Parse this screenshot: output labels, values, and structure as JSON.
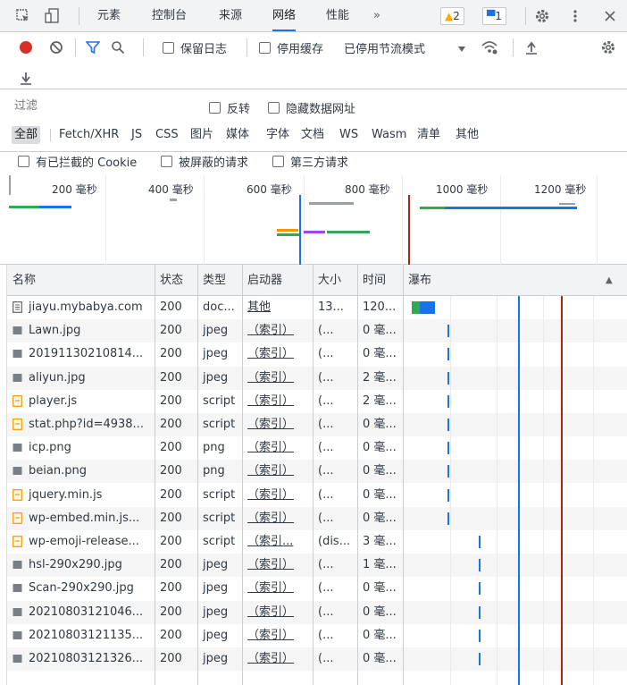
{
  "tabs": {
    "elements": "元素",
    "console": "控制台",
    "sources": "来源",
    "network": "网络",
    "performance": "性能",
    "more": "»",
    "warnings": "2",
    "messages": "1"
  },
  "toolbar": {
    "preserve_log": "保留日志",
    "disable_cache": "停用缓存",
    "throttling": "已停用节流模式"
  },
  "filter": {
    "placeholder": "过滤",
    "invert": "反转",
    "hide_data_urls": "隐藏数据网址",
    "types": [
      "全部",
      "Fetch/XHR",
      "JS",
      "CSS",
      "图片",
      "媒体",
      "字体",
      "文档",
      "WS",
      "Wasm",
      "清单",
      "其他"
    ],
    "blocked_cookies": "有已拦截的 Cookie",
    "blocked_requests": "被屏蔽的请求",
    "third_party": "第三方请求"
  },
  "overview": {
    "ticks": [
      "200 毫秒",
      "400 毫秒",
      "600 毫秒",
      "800 毫秒",
      "1000 毫秒",
      "1200 毫秒"
    ]
  },
  "table": {
    "headers": [
      "名称",
      "状态",
      "类型",
      "启动器",
      "大小",
      "时间",
      "瀑布"
    ],
    "rows": [
      {
        "name": "jiayu.mybabya.com",
        "status": "200",
        "type": "doc...",
        "initiator": "其他",
        "size": "13...",
        "time": "120...",
        "icon": "document-icon",
        "wf": 0.02
      },
      {
        "name": "Lawn.jpg",
        "status": "200",
        "type": "jpeg",
        "initiator": "（索引）",
        "size": "(...",
        "time": "0 毫...",
        "icon": "image-icon",
        "wf": 0.2
      },
      {
        "name": "20191130210814...",
        "status": "200",
        "type": "jpeg",
        "initiator": "（索引）",
        "size": "(...",
        "time": "0 毫...",
        "icon": "image-icon",
        "wf": 0.2
      },
      {
        "name": "aliyun.jpg",
        "status": "200",
        "type": "jpeg",
        "initiator": "（索引）",
        "size": "(...",
        "time": "2 毫...",
        "icon": "image-icon",
        "wf": 0.2
      },
      {
        "name": "player.js",
        "status": "200",
        "type": "script",
        "initiator": "（索引）",
        "size": "(...",
        "time": "2 毫...",
        "icon": "script-icon",
        "wf": 0.2
      },
      {
        "name": "stat.php?id=4938...",
        "status": "200",
        "type": "script",
        "initiator": "（索引）",
        "size": "(...",
        "time": "0 毫...",
        "icon": "script-icon",
        "wf": 0.2
      },
      {
        "name": "icp.png",
        "status": "200",
        "type": "png",
        "initiator": "（索引）",
        "size": "(...",
        "time": "0 毫...",
        "icon": "image-icon",
        "wf": 0.2
      },
      {
        "name": "beian.png",
        "status": "200",
        "type": "png",
        "initiator": "（索引）",
        "size": "(...",
        "time": "0 毫...",
        "icon": "image-icon",
        "wf": 0.2
      },
      {
        "name": "jquery.min.js",
        "status": "200",
        "type": "script",
        "initiator": "（索引）",
        "size": "(...",
        "time": "0 毫...",
        "icon": "script-icon",
        "wf": 0.2
      },
      {
        "name": "wp-embed.min.js...",
        "status": "200",
        "type": "script",
        "initiator": "（索引）",
        "size": "(...",
        "time": "0 毫...",
        "icon": "script-icon",
        "wf": 0.2
      },
      {
        "name": "wp-emoji-release...",
        "status": "200",
        "type": "script",
        "initiator": "（索引...",
        "size": "(dis...",
        "time": "3 毫...",
        "icon": "script-icon",
        "wf": 0.34
      },
      {
        "name": "hsl-290x290.jpg",
        "status": "200",
        "type": "jpeg",
        "initiator": "（索引）",
        "size": "(...",
        "time": "1 毫...",
        "icon": "image-icon",
        "wf": 0.34
      },
      {
        "name": "Scan-290x290.jpg",
        "status": "200",
        "type": "jpeg",
        "initiator": "（索引）",
        "size": "(...",
        "time": "0 毫...",
        "icon": "image-icon",
        "wf": 0.34
      },
      {
        "name": "20210803121046...",
        "status": "200",
        "type": "jpeg",
        "initiator": "（索引）",
        "size": "(...",
        "time": "0 毫...",
        "icon": "image-icon",
        "wf": 0.34
      },
      {
        "name": "20210803121135...",
        "status": "200",
        "type": "jpeg",
        "initiator": "（索引）",
        "size": "(...",
        "time": "0 毫...",
        "icon": "image-icon",
        "wf": 0.34
      },
      {
        "name": "20210803121326...",
        "status": "200",
        "type": "jpeg",
        "initiator": "（索引）",
        "size": "(...",
        "time": "0 毫...",
        "icon": "image-icon",
        "wf": 0.34
      }
    ]
  },
  "colors": {
    "accent": "#1a73e8",
    "record": "#d93025",
    "warning": "#f9ab00",
    "filter_blue": "#1a73e8",
    "wf_blue": "#1a73e8",
    "load_line": "#a52714",
    "dom_line": "#1a73e8"
  }
}
